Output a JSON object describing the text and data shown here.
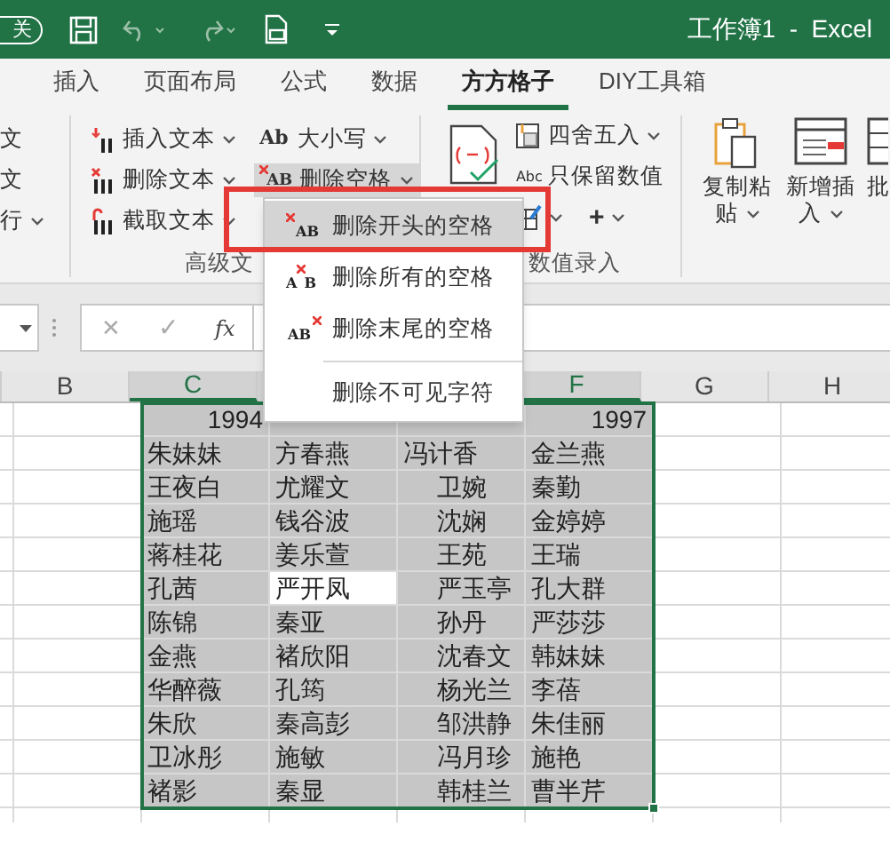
{
  "window": {
    "toggle": "关",
    "title": "工作簿1  -  Excel"
  },
  "tabs": [
    {
      "label": "插入",
      "selected": false
    },
    {
      "label": "页面布局",
      "selected": false
    },
    {
      "label": "公式",
      "selected": false
    },
    {
      "label": "数据",
      "selected": false
    },
    {
      "label": "方方格子",
      "selected": true
    },
    {
      "label": "DIY工具箱",
      "selected": false
    }
  ],
  "ribbon": {
    "partial_group": [
      {
        "label": "文",
        "dropdown": false
      },
      {
        "label": "文",
        "dropdown": false
      },
      {
        "label": "行",
        "dropdown": true
      }
    ],
    "text_group": {
      "label": "高级文",
      "column_1": [
        {
          "kind": "insert",
          "label": "插入文本"
        },
        {
          "kind": "delete",
          "label": "删除文本"
        },
        {
          "kind": "extract",
          "label": "截取文本"
        }
      ],
      "column_2": [
        {
          "kind": "case",
          "icon_text": "Ab",
          "label": "大小写",
          "open": false
        },
        {
          "kind": "spaces",
          "icon_text": "AB",
          "label": "删除空格",
          "open": true
        }
      ]
    },
    "number_group": {
      "label": "数值录入",
      "items": [
        {
          "kind": "round",
          "label": "四舍五入"
        },
        {
          "kind": "keep",
          "icon_text": "Abc",
          "label": "只保留数值"
        }
      ],
      "plus": "+"
    },
    "clipboard_group": [
      {
        "line_1": "复制粘",
        "line_2": "贴"
      },
      {
        "line_1": "新增插",
        "line_2": "入"
      }
    ],
    "cut_label": "批"
  },
  "formula_bar": {
    "cancel": "✕",
    "confirm": "✓",
    "fx": "fx"
  },
  "columns": [
    {
      "label": "B",
      "selected": false
    },
    {
      "label": "C",
      "selected": true
    },
    {
      "label": "F",
      "selected": true
    },
    {
      "label": "G",
      "selected": false
    },
    {
      "label": "H",
      "selected": false
    }
  ],
  "rows": [
    {
      "kind": "number",
      "cells": [
        {
          "text": "1994",
          "active": false
        },
        {
          "active": false
        },
        {
          "active": false
        },
        {
          "text": "1997",
          "active": false
        }
      ]
    },
    {
      "kind": "text",
      "cells": [
        {
          "text": "朱妹妹",
          "active": false,
          "indented": false
        },
        {
          "text": "方春燕",
          "active": false,
          "indented": false
        },
        {
          "text": "冯计香",
          "active": false,
          "indented": false
        },
        {
          "text": "金兰燕",
          "active": false,
          "indented": false
        }
      ]
    },
    {
      "kind": "text",
      "cells": [
        {
          "text": "王夜白",
          "active": false,
          "indented": false
        },
        {
          "text": "尤耀文",
          "active": false,
          "indented": false
        },
        {
          "text": "卫婉",
          "active": false,
          "indented": true
        },
        {
          "text": "秦勤",
          "active": false,
          "indented": false
        }
      ]
    },
    {
      "kind": "text",
      "cells": [
        {
          "text": "施瑶",
          "active": false,
          "indented": false
        },
        {
          "text": "钱谷波",
          "active": false,
          "indented": false
        },
        {
          "text": "沈娴",
          "active": false,
          "indented": true
        },
        {
          "text": "金婷婷",
          "active": false,
          "indented": false
        }
      ]
    },
    {
      "kind": "text",
      "cells": [
        {
          "text": "蒋桂花",
          "active": false,
          "indented": false
        },
        {
          "text": "姜乐萱",
          "active": false,
          "indented": false
        },
        {
          "text": "王苑",
          "active": false,
          "indented": true
        },
        {
          "text": "王瑞",
          "active": false,
          "indented": false
        }
      ]
    },
    {
      "kind": "text",
      "cells": [
        {
          "text": "孔茜",
          "active": false,
          "indented": false
        },
        {
          "text": "严开凤",
          "active": true,
          "indented": false
        },
        {
          "text": "严玉亭",
          "active": false,
          "indented": true
        },
        {
          "text": "孔大群",
          "active": false,
          "indented": false
        }
      ]
    },
    {
      "kind": "text",
      "cells": [
        {
          "text": "陈锦",
          "active": false,
          "indented": false
        },
        {
          "text": "秦亚",
          "active": false,
          "indented": false
        },
        {
          "text": "孙丹",
          "active": false,
          "indented": true
        },
        {
          "text": "严莎莎",
          "active": false,
          "indented": false
        }
      ]
    },
    {
      "kind": "text",
      "cells": [
        {
          "text": "金燕",
          "active": false,
          "indented": false
        },
        {
          "text": "褚欣阳",
          "active": false,
          "indented": false
        },
        {
          "text": "沈春文",
          "active": false,
          "indented": true
        },
        {
          "text": "韩妹妹",
          "active": false,
          "indented": false
        }
      ]
    },
    {
      "kind": "text",
      "cells": [
        {
          "text": "华醉薇",
          "active": false,
          "indented": false
        },
        {
          "text": "孔筠",
          "active": false,
          "indented": false
        },
        {
          "text": "杨光兰",
          "active": false,
          "indented": true
        },
        {
          "text": "李蓓",
          "active": false,
          "indented": false
        }
      ]
    },
    {
      "kind": "text",
      "cells": [
        {
          "text": "朱欣",
          "active": false,
          "indented": false
        },
        {
          "text": "秦高彭",
          "active": false,
          "indented": false
        },
        {
          "text": "邹洪静",
          "active": false,
          "indented": true
        },
        {
          "text": "朱佳丽",
          "active": false,
          "indented": false
        }
      ]
    },
    {
      "kind": "text",
      "cells": [
        {
          "text": "卫冰彤",
          "active": false,
          "indented": false
        },
        {
          "text": "施敏",
          "active": false,
          "indented": false
        },
        {
          "text": "冯月珍",
          "active": false,
          "indented": true
        },
        {
          "text": "施艳",
          "active": false,
          "indented": false
        }
      ]
    },
    {
      "kind": "text",
      "cells": [
        {
          "text": "褚影",
          "active": false,
          "indented": false
        },
        {
          "text": "秦显",
          "active": false,
          "indented": false
        },
        {
          "text": "韩桂兰",
          "active": false,
          "indented": true
        },
        {
          "text": "曹半芹",
          "active": false,
          "indented": false
        }
      ]
    }
  ],
  "menu": {
    "items": [
      {
        "kind": "leading",
        "icon_text": "AB",
        "label": "删除开头的空格",
        "selected": true
      },
      {
        "kind": "all",
        "icon_text": "AB",
        "label": "删除所有的空格",
        "selected": false
      },
      {
        "kind": "trailing",
        "icon_text": "AB",
        "label": "删除末尾的空格",
        "selected": false
      },
      {
        "kind": "plain",
        "label": "删除不可见字符",
        "selected": false
      }
    ]
  }
}
